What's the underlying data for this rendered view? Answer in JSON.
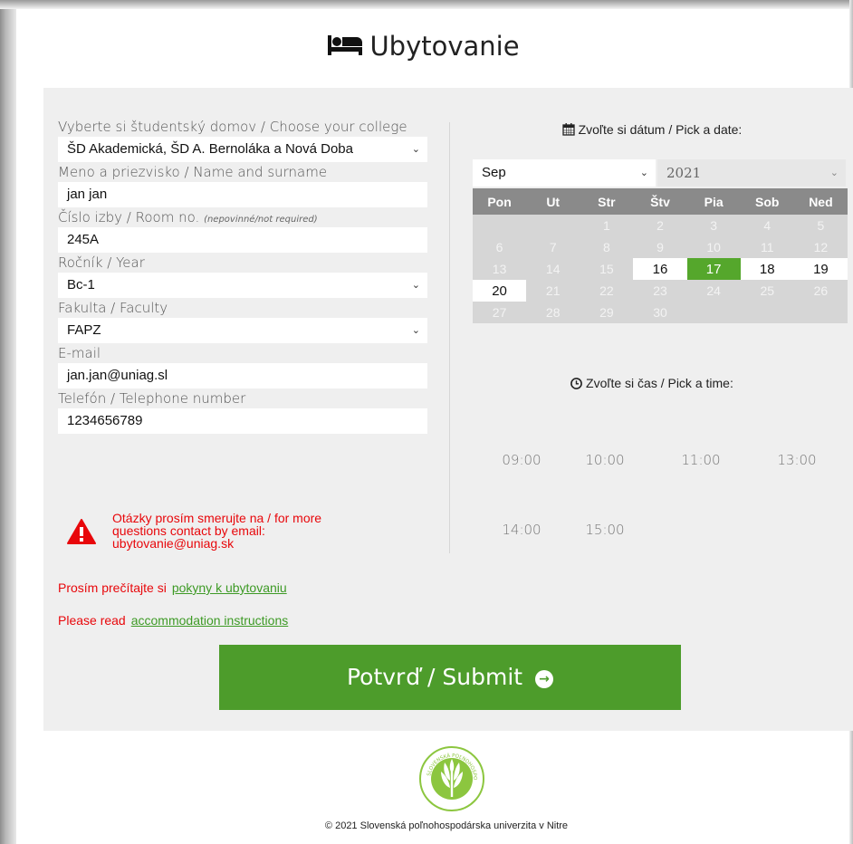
{
  "page": {
    "title": "Ubytovanie"
  },
  "form": {
    "college_label": "Vyberte si študentský domov / Choose your college",
    "college_value": "ŠD Akademická, ŠD A. Bernoláka a Nová Doba",
    "name_label": "Meno a priezvisko / Name and surname",
    "name_value": "jan jan",
    "room_label": "Číslo izby / Room no.",
    "room_note": "(nepovinné/not required)",
    "room_value": "245A",
    "year_label": "Ročník / Year",
    "year_value": "Bc-1",
    "faculty_label": "Fakulta / Faculty",
    "faculty_value": "FAPZ",
    "email_label": "E-mail",
    "email_value": "jan.jan@uniag.sl",
    "phone_label": "Telefón / Telephone number",
    "phone_value": "1234656789"
  },
  "alert": {
    "text": "Otázky prosím smerujte na / for more questions contact by email: ubytovanie@uniag.sk"
  },
  "instructions": {
    "sk_text": "Prosím prečítajte si",
    "sk_link": "pokyny k ubytovaniu",
    "en_text": "Please read",
    "en_link": "accommodation instructions"
  },
  "calendar": {
    "title": "Zvoľte si dátum / Pick a date:",
    "month": "Sep",
    "year": "2021",
    "weekdays": [
      "Pon",
      "Ut",
      "Str",
      "Štv",
      "Pia",
      "Sob",
      "Ned"
    ],
    "weeks": [
      [
        "",
        "",
        "1",
        "2",
        "3",
        "4",
        "5"
      ],
      [
        "6",
        "7",
        "8",
        "9",
        "10",
        "11",
        "12"
      ],
      [
        "13",
        "14",
        "15",
        "16",
        "17",
        "18",
        "19"
      ],
      [
        "20",
        "21",
        "22",
        "23",
        "24",
        "25",
        "26"
      ],
      [
        "27",
        "28",
        "29",
        "30",
        "",
        "",
        ""
      ]
    ],
    "available": [
      "16",
      "17",
      "18",
      "19",
      "20"
    ],
    "selected": "17",
    "colors": {
      "header": "#8a8a8a",
      "disabled": "#d6d6d6",
      "selected": "#55a72c"
    }
  },
  "time": {
    "title": "Zvoľte si čas / Pick a time:",
    "slots": [
      "09:00",
      "10:00",
      "11:00",
      "13:00",
      "14:00",
      "15:00"
    ]
  },
  "submit": {
    "label": "Potvrď / Submit"
  },
  "footer": {
    "text": "© 2021 Slovenská poľnohospodárska univerzita v Nitre"
  },
  "colors": {
    "brand_green": "#4d9c2b",
    "alert_red": "#e8070b"
  },
  "icons": {
    "title": "bed-icon",
    "date": "calendar-icon",
    "time": "clock-icon",
    "alert": "warning-triangle-icon",
    "submit": "arrow-circle-right-icon"
  }
}
